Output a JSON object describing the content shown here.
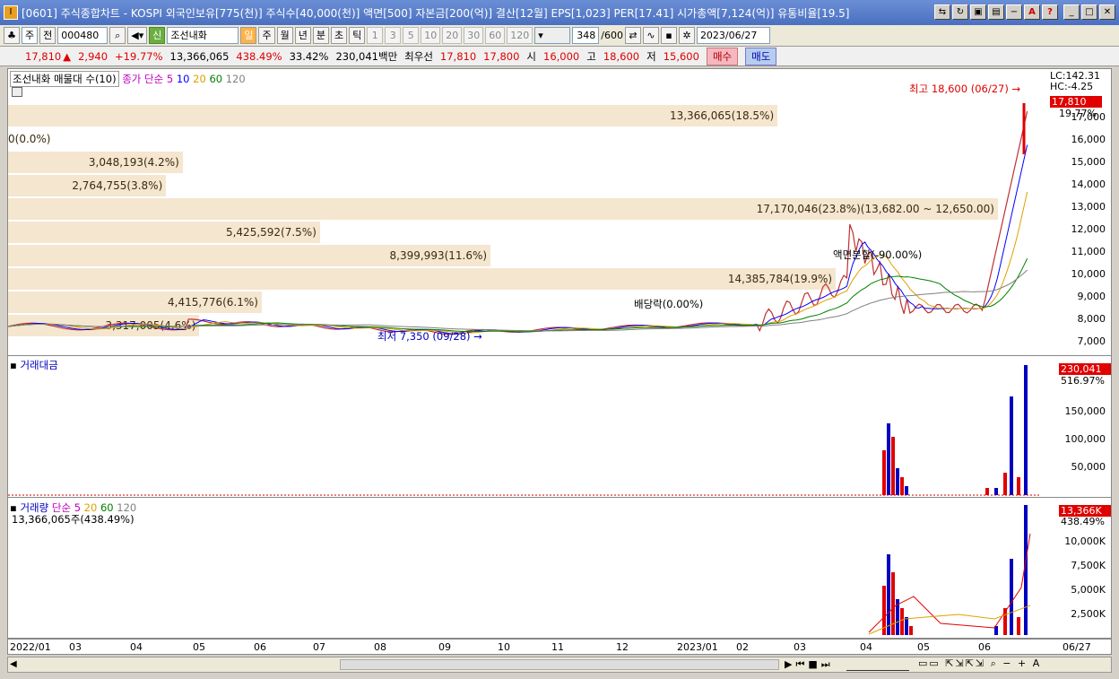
{
  "window": {
    "title": "[0601] 주식종합차트 - KOSPI 외국인보유[775(천)] 주식수[40,000(천)] 액면[500] 자본금[200(억)] 결산[12월] EPS[1,023] PER[17.41] 시가총액[7,124(억)] 유통비율[19.5]",
    "app_icon": "I"
  },
  "toolbar": {
    "type_select": "주",
    "prev_label": "전",
    "code": "000480",
    "stock_name_badge": "신",
    "stock_name": "조선내화",
    "periods": [
      "일",
      "주",
      "월",
      "년",
      "분",
      "초",
      "틱"
    ],
    "minutes": [
      "1",
      "3",
      "5",
      "10",
      "20",
      "30",
      "60",
      "120"
    ],
    "count": "348",
    "count_max": "/600",
    "date": "2023/06/27"
  },
  "info": {
    "price": "17,810",
    "change": "2,940",
    "change_pct": "+19.77%",
    "volume": "13,366,065",
    "volume_ratio": "438.49%",
    "turnover": "33.42%",
    "amount": "230,041백만",
    "best_label": "최우선",
    "best_ask": "17,810",
    "best_bid": "17,800",
    "open_label": "시",
    "open": "16,000",
    "high_label": "고",
    "high": "18,600",
    "low_label": "저",
    "low": "15,600",
    "buy_label": "매수",
    "sell_label": "매도"
  },
  "price_pane": {
    "legend_box": "조선내화 매물대 수(10)",
    "ma_label": "종가 단순",
    "ma_periods": [
      "5",
      "10",
      "20",
      "60",
      "120"
    ],
    "lc": "LC:142.31",
    "hc": "HC:-4.25",
    "current_tag": "17,810",
    "current_pct": "19.77%",
    "y_ticks": [
      "17,000",
      "16,000",
      "15,000",
      "14,000",
      "13,000",
      "12,000",
      "11,000",
      "10,000",
      "9,000",
      "8,000",
      "7,000"
    ],
    "high_annot": "최고 18,600 (06/27)",
    "low_annot": "최저 7,350 (09/28)",
    "dividend_annot": "배당락(0.00%)",
    "split_annot": "액면분할(-90.00%)",
    "volume_profile": [
      {
        "label": "13,366,065(18.5%)",
        "pct": 18.5
      },
      {
        "label": "0(0.0%)",
        "pct": 0
      },
      {
        "label": "3,048,193(4.2%)",
        "pct": 4.2
      },
      {
        "label": "2,764,755(3.8%)",
        "pct": 3.8
      },
      {
        "label": "17,170,046(23.8%)(13,682.00 ~ 12,650.00)",
        "pct": 23.8
      },
      {
        "label": "5,425,592(7.5%)",
        "pct": 7.5
      },
      {
        "label": "8,399,993(11.6%)",
        "pct": 11.6
      },
      {
        "label": "14,385,784(19.9%)",
        "pct": 19.9
      },
      {
        "label": "4,415,776(6.1%)",
        "pct": 6.1
      },
      {
        "label": "3,317,005(4.6%)",
        "pct": 4.6
      }
    ]
  },
  "amount_pane": {
    "legend": "거래대금",
    "current_tag": "230,041",
    "current_pct": "516.97%",
    "y_ticks": [
      "150,000",
      "100,000",
      "50,000"
    ]
  },
  "volume_pane": {
    "legend": "거래량",
    "ma_label": "단순",
    "ma_periods": [
      "5",
      "20",
      "60",
      "120"
    ],
    "current_text": "13,366,065주(438.49%)",
    "current_tag": "13,366K",
    "current_pct": "438.49%",
    "y_ticks": [
      "10,000K",
      "7,500K",
      "5,000K",
      "2,500K"
    ]
  },
  "x_axis": {
    "labels": [
      "2022/01",
      "03",
      "04",
      "05",
      "06",
      "07",
      "08",
      "09",
      "10",
      "11",
      "12",
      "2023/01",
      "02",
      "03",
      "04",
      "05",
      "06"
    ],
    "end_label": "06/27"
  },
  "colors": {
    "up": "#e00000",
    "down": "#0000c0",
    "ma5": "#c000c0",
    "ma10": "#0000ff",
    "ma20": "#e0a000",
    "ma60": "#008000",
    "ma120": "#808080",
    "profile": "#f5e6d0"
  }
}
